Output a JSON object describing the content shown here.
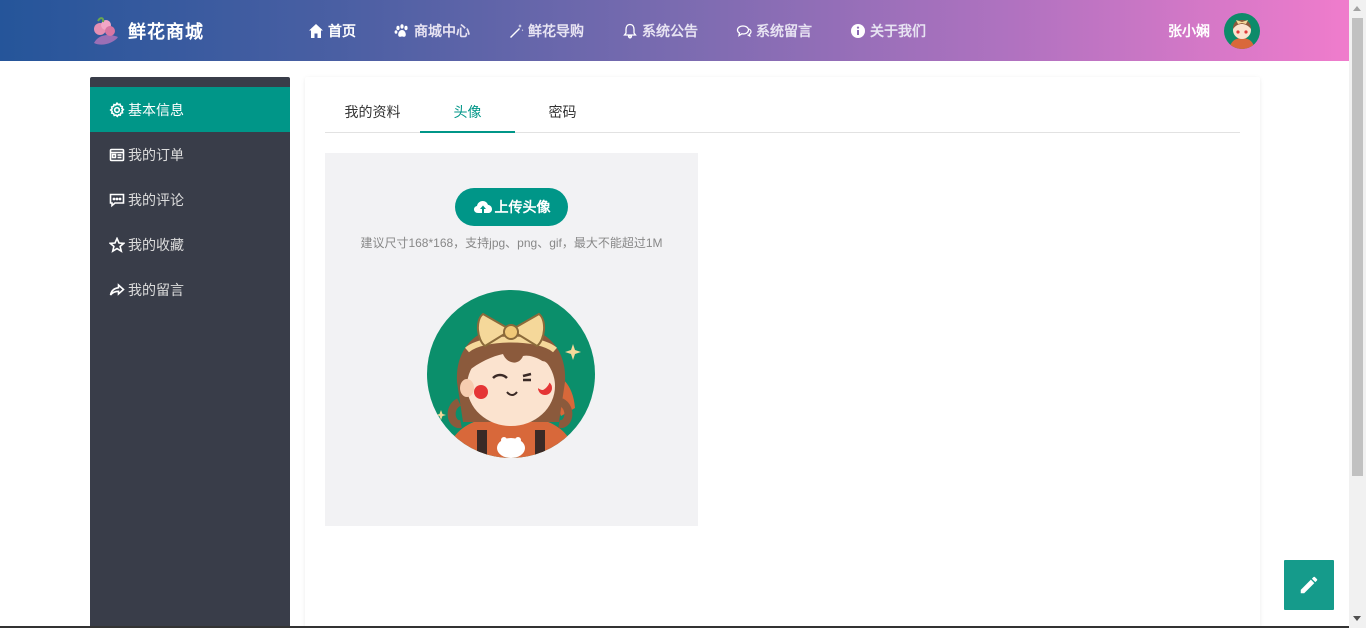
{
  "header": {
    "brand": "鲜花商城",
    "nav": [
      {
        "label": "首页",
        "icon": "home-icon"
      },
      {
        "label": "商城中心",
        "icon": "paw-icon"
      },
      {
        "label": "鲜花导购",
        "icon": "magic-wand-icon"
      },
      {
        "label": "系统公告",
        "icon": "bell-icon"
      },
      {
        "label": "系统留言",
        "icon": "chat-icon"
      },
      {
        "label": "关于我们",
        "icon": "info-icon"
      }
    ],
    "user_name": "张小娴"
  },
  "sidebar": {
    "items": [
      {
        "label": "基本信息",
        "icon": "gear-icon",
        "active": true
      },
      {
        "label": "我的订单",
        "icon": "order-icon"
      },
      {
        "label": "我的评论",
        "icon": "comment-icon"
      },
      {
        "label": "我的收藏",
        "icon": "star-icon"
      },
      {
        "label": "我的留言",
        "icon": "share-icon"
      }
    ]
  },
  "tabs": [
    {
      "label": "我的资料"
    },
    {
      "label": "头像",
      "active": true
    },
    {
      "label": "密码"
    }
  ],
  "avatar": {
    "upload_label": "上传头像",
    "hint": "建议尺寸168*168，支持jpg、png、gif，最大不能超过1M"
  },
  "colors": {
    "accent": "#009688",
    "sidebar_bg": "#393d49",
    "header_gradient_start": "#25559a",
    "header_gradient_end": "#f07ccc"
  }
}
